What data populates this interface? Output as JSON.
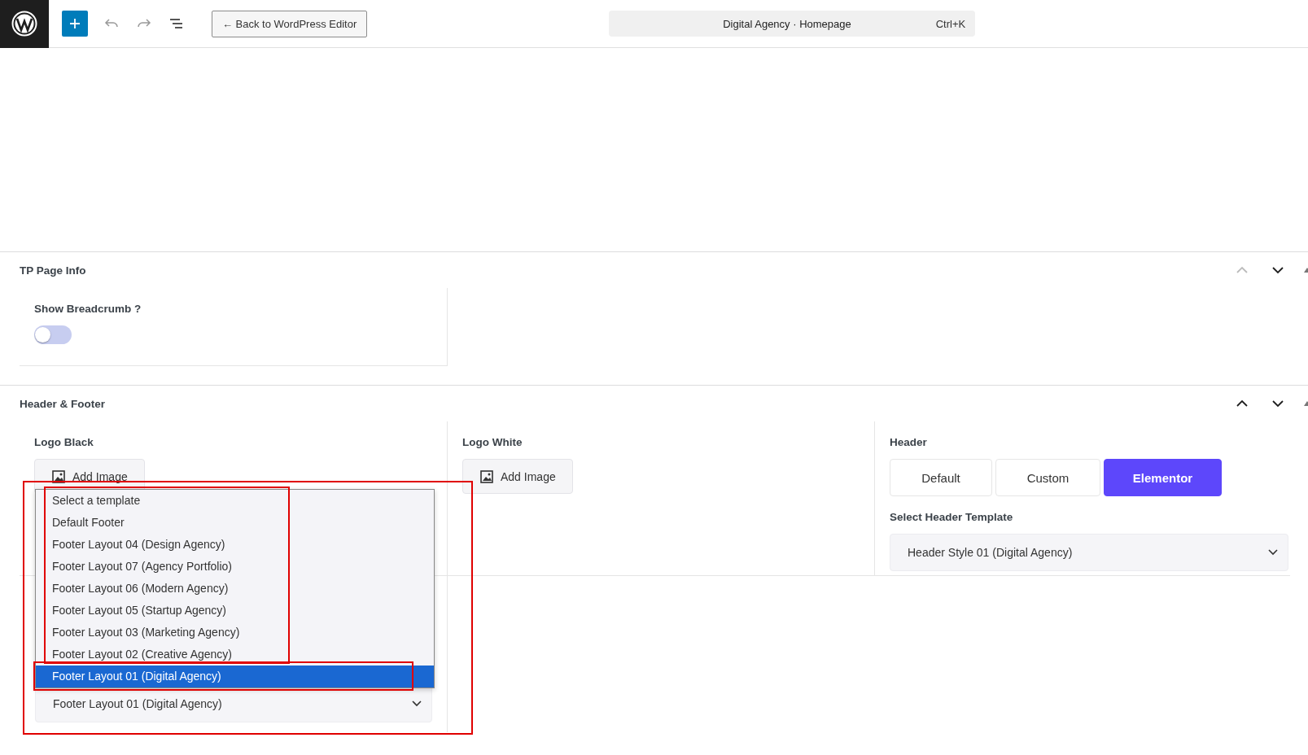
{
  "toolbar": {
    "back_button": "← Back to WordPress Editor",
    "search": {
      "title": "Digital Agency · Homepage",
      "shortcut": "Ctrl+K"
    }
  },
  "sections": [
    {
      "kind": "page-info",
      "title": "TP Page Info",
      "move_up_disabled": true,
      "fields": [
        {
          "label": "Show Breadcrumb ?",
          "on": false
        }
      ]
    },
    {
      "kind": "header-footer",
      "title": "Header & Footer",
      "move_up_disabled": false,
      "logo_black": {
        "label": "Logo Black",
        "button": "Add Image"
      },
      "logo_white": {
        "label": "Logo White",
        "button": "Add Image"
      },
      "header": {
        "label": "Header",
        "options": [
          {
            "label": "Default",
            "selected": false
          },
          {
            "label": "Custom",
            "selected": false
          },
          {
            "label": "Elementor",
            "selected": true
          }
        ],
        "template_label": "Select Header Template",
        "template_value": "Header Style 01 (Digital Agency)"
      },
      "footer_select": {
        "value": "Footer Layout 01 (Digital Agency)",
        "options": [
          {
            "label": "Select a template",
            "selected": false
          },
          {
            "label": "Default Footer",
            "selected": false
          },
          {
            "label": "Footer Layout 04 (Design Agency)",
            "selected": false
          },
          {
            "label": "Footer Layout 07 (Agency Portfolio)",
            "selected": false
          },
          {
            "label": "Footer Layout 06 (Modern Agency)",
            "selected": false
          },
          {
            "label": "Footer Layout 05 (Startup Agency)",
            "selected": false
          },
          {
            "label": "Footer Layout 03 (Marketing Agency)",
            "selected": false
          },
          {
            "label": "Footer Layout 02 (Creative Agency)",
            "selected": false
          },
          {
            "label": "Footer Layout 01 (Digital Agency)",
            "selected": true
          }
        ]
      },
      "annotations": [
        {
          "kind": "footer-area"
        },
        {
          "kind": "option-group"
        },
        {
          "kind": "selected-option"
        }
      ]
    }
  ]
}
